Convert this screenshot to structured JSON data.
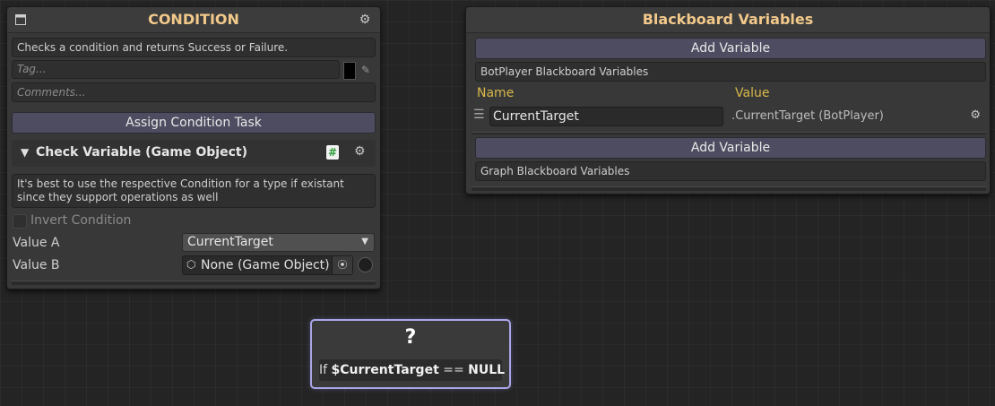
{
  "condition_panel": {
    "title": "CONDITION",
    "description": "Checks a condition and returns Success or Failure.",
    "tag_placeholder": "Tag...",
    "comments_placeholder": "Comments...",
    "assign_button": "Assign Condition Task",
    "task_title": "Check Variable (Game Object)",
    "task_hint_line1": "It's best to use the respective Condition for a type if existant",
    "task_hint_line2": "since they support operations as well",
    "invert_label": "Invert Condition",
    "value_a_label": "Value A",
    "value_a_selected": "CurrentTarget",
    "value_b_label": "Value B",
    "value_b_value": "None (Game Object)"
  },
  "blackboard_panel": {
    "title": "Blackboard Variables",
    "add_variable_1": "Add Variable",
    "section_1": "BotPlayer Blackboard Variables",
    "col_name": "Name",
    "col_value": "Value",
    "variable_name": "CurrentTarget",
    "variable_value": ".CurrentTarget (BotPlayer)",
    "add_variable_2": "Add Variable",
    "section_2": "Graph Blackboard Variables"
  },
  "node": {
    "icon_glyph": "?",
    "prefix": "If ",
    "variable": "$CurrentTarget",
    "operator": " == ",
    "literal": "NULL"
  },
  "colors": {
    "header_text": "#f2c98a",
    "column_header": "#d8b84a",
    "button_bar": "#4d4c60",
    "node_outline": "#a9a6e8",
    "script_icon": "#4caf50"
  },
  "icons": [
    "window-icon",
    "gear-icon",
    "eyedropper-icon",
    "script-icon",
    "dropdown-arrow-icon",
    "object-icon",
    "target-icon",
    "drag-handle-icon",
    "question-icon"
  ]
}
